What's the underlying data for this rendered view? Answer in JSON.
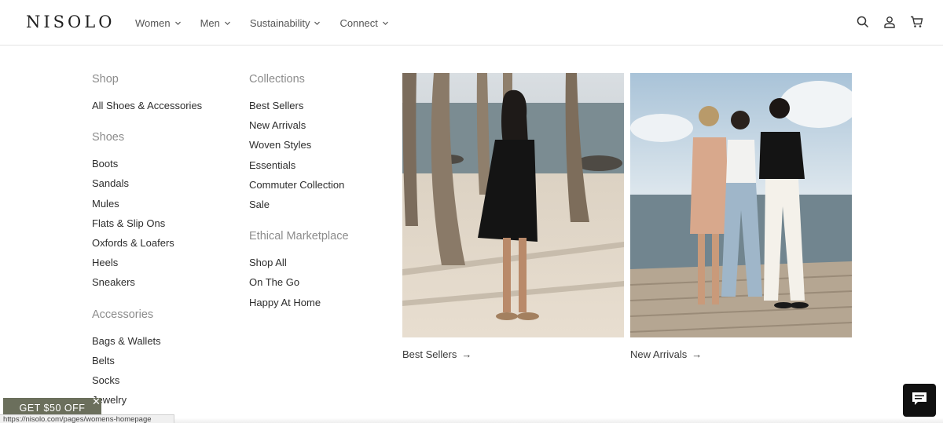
{
  "brand": {
    "logo_text": "NISOLO"
  },
  "nav": {
    "items": [
      {
        "label": "Women"
      },
      {
        "label": "Men"
      },
      {
        "label": "Sustainability"
      },
      {
        "label": "Connect"
      }
    ]
  },
  "header_icons": [
    "search-icon",
    "account-icon",
    "cart-icon"
  ],
  "menu": {
    "shop": {
      "heading": "Shop",
      "links": [
        "All Shoes & Accessories"
      ]
    },
    "shoes": {
      "heading": "Shoes",
      "links": [
        "Boots",
        "Sandals",
        "Mules",
        "Flats & Slip Ons",
        "Oxfords & Loafers",
        "Heels",
        "Sneakers"
      ]
    },
    "accessories": {
      "heading": "Accessories",
      "links": [
        "Bags & Wallets",
        "Belts",
        "Socks",
        "Jewelry"
      ]
    },
    "collections": {
      "heading": "Collections",
      "links": [
        "Best Sellers",
        "New Arrivals",
        "Woven Styles",
        "Essentials",
        "Commuter Collection",
        "Sale"
      ]
    },
    "ethical": {
      "heading": "Ethical Marketplace",
      "links": [
        "Shop All",
        "On The Go",
        "Happy At Home"
      ]
    }
  },
  "features": [
    {
      "caption": "Best Sellers",
      "arrow": "→"
    },
    {
      "caption": "New Arrivals",
      "arrow": "→"
    }
  ],
  "promo": {
    "label": "GET $50 OFF",
    "close": "✕"
  },
  "status_bar": {
    "url": "https://nisolo.com/pages/womens-homepage"
  },
  "colors": {
    "promo_bg": "#6b6f5c",
    "chat_bg": "#111111",
    "heading_gray": "#8c8c8c"
  }
}
